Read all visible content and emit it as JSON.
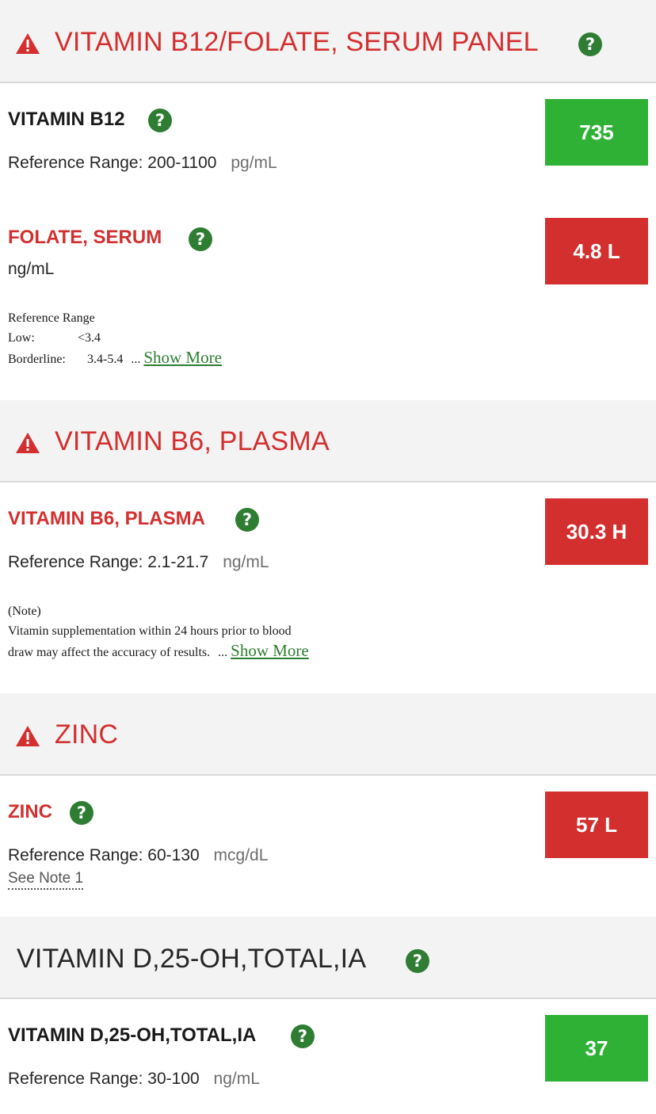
{
  "panels": [
    {
      "title": "VITAMIN B12/FOLATE, SERUM PANEL",
      "tests": [
        {
          "name": "VITAMIN B12",
          "reference_label": "Reference Range:",
          "reference_range": "200-1100",
          "unit": "pg/mL",
          "value": "735",
          "status": "normal"
        },
        {
          "name": "FOLATE, SERUM",
          "unit": "ng/mL",
          "value": "4.8 L",
          "status": "low",
          "note": {
            "heading": "Reference Range",
            "low_label": "Low:",
            "low_value": "<3.4",
            "borderline_label": "Borderline:",
            "borderline_value": "3.4-5.4",
            "ellipsis": "...",
            "show_more": "Show More"
          }
        }
      ]
    },
    {
      "title": "VITAMIN B6, PLASMA",
      "tests": [
        {
          "name": "VITAMIN B6, PLASMA",
          "reference_label": "Reference Range:",
          "reference_range": "2.1-21.7",
          "unit": "ng/mL",
          "value": "30.3 H",
          "status": "high",
          "note": {
            "line1": "(Note)",
            "line2": "Vitamin supplementation within 24 hours prior to blood",
            "line3": "draw may affect the accuracy of results.",
            "ellipsis": "...",
            "show_more": "Show More"
          }
        }
      ]
    },
    {
      "title": "ZINC",
      "tests": [
        {
          "name": "ZINC",
          "reference_label": "Reference Range:",
          "reference_range": "60-130",
          "unit": "mcg/dL",
          "value": "57 L",
          "status": "low",
          "see_note": "See Note 1"
        }
      ]
    },
    {
      "title": "VITAMIN D,25-OH,TOTAL,IA",
      "tests": [
        {
          "name": "VITAMIN D,25-OH,TOTAL,IA",
          "reference_label": "Reference Range:",
          "reference_range": "30-100",
          "unit": "ng/mL",
          "value": "37",
          "status": "normal"
        }
      ]
    }
  ],
  "icons": {
    "warning": "warning-triangle-icon",
    "help": "help-question-icon",
    "help_glyph": "?"
  },
  "colors": {
    "alert_red": "#d32f2f",
    "normal_green": "#2eb135",
    "help_green": "#2e7d32",
    "header_gray": "#f3f3f3"
  }
}
